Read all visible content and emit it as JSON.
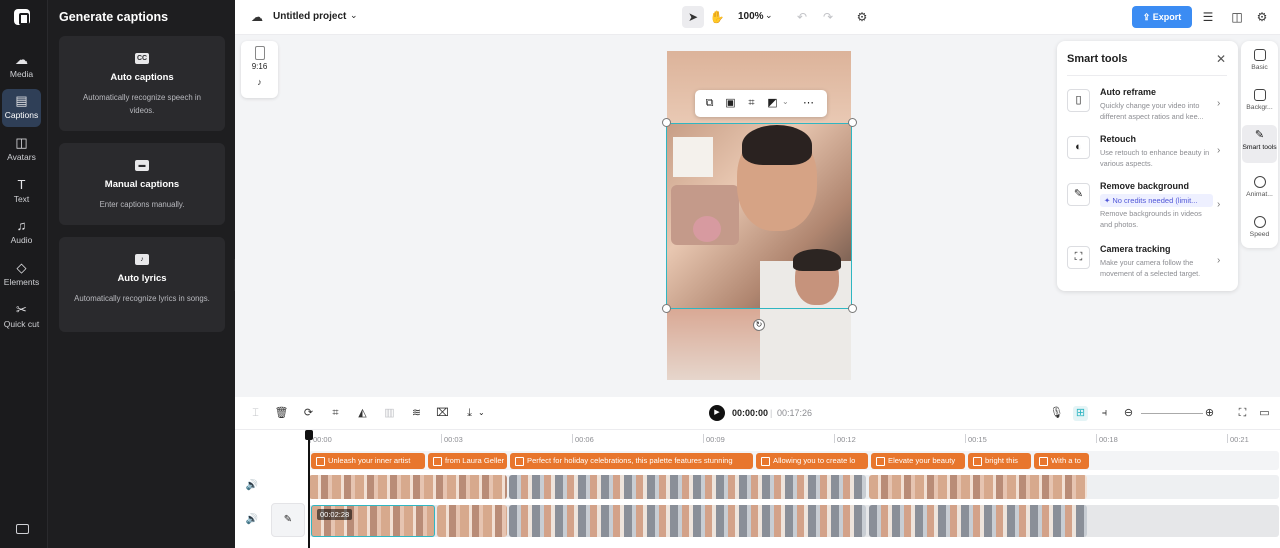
{
  "rail": {
    "items": [
      {
        "label": "Media",
        "icon": "cloud-icon"
      },
      {
        "label": "Captions",
        "icon": "captions-icon"
      },
      {
        "label": "Avatars",
        "icon": "avatar-icon"
      },
      {
        "label": "Text",
        "icon": "text-icon"
      },
      {
        "label": "Audio",
        "icon": "music-icon"
      },
      {
        "label": "Elements",
        "icon": "elements-icon"
      },
      {
        "label": "Quick cut",
        "icon": "scissors-icon"
      }
    ],
    "active": "Captions"
  },
  "panel": {
    "title": "Generate captions",
    "cards": [
      {
        "title": "Auto captions",
        "desc": "Automatically recognize speech in videos.",
        "icon_text": "CC"
      },
      {
        "title": "Manual captions",
        "desc": "Enter captions manually.",
        "icon_text": "▬"
      },
      {
        "title": "Auto lyrics",
        "desc": "Automatically recognize lyrics in songs.",
        "icon_text": "♪"
      }
    ]
  },
  "topbar": {
    "project_name": "Untitled project",
    "zoom": "100%",
    "export_label": "Export"
  },
  "stage": {
    "ratio": "9:16"
  },
  "smart_tools": {
    "title": "Smart tools",
    "tools": [
      {
        "name": "Auto reframe",
        "desc": "Quickly change your video into different aspect ratios and kee..."
      },
      {
        "name": "Retouch",
        "desc": "Use retouch to enhance beauty in various aspects."
      },
      {
        "name": "Remove background",
        "credit": "No credits needed (limit...",
        "desc": "Remove backgrounds in videos and photos."
      },
      {
        "name": "Camera tracking",
        "desc": "Make your camera follow the movement of a selected target."
      }
    ]
  },
  "right_rail": {
    "items": [
      "Basic",
      "Backgr...",
      "Smart tools",
      "Animat...",
      "Speed"
    ],
    "active": "Smart tools"
  },
  "timeline": {
    "current_time": "00:00:00",
    "duration": "00:17:26",
    "ticks": [
      "00:00",
      "00:03",
      "00:06",
      "00:09",
      "00:12",
      "00:15",
      "00:18",
      "00:21"
    ],
    "captions": [
      "Unleash your inner artist",
      "from Laura Geller",
      "Perfect for holiday celebrations, this palette features stunning",
      "Allowing you to create lo",
      "Elevate your beauty",
      "bright this",
      "With a to"
    ],
    "clip_time": "00:02:28"
  },
  "colors": {
    "accent": "#3b8cf3",
    "selection": "#2fb6c2",
    "caption": "#e8762d"
  }
}
